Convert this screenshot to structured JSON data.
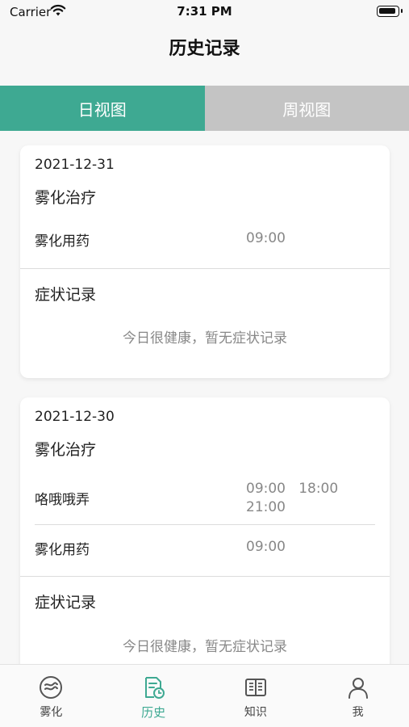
{
  "status_bar": {
    "carrier": "Carrier",
    "time": "7:31 PM"
  },
  "nav": {
    "title": "历史记录"
  },
  "tabs": [
    {
      "label": "日视图",
      "active": true
    },
    {
      "label": "周视图",
      "active": false
    }
  ],
  "records": [
    {
      "date": "2021-12-31",
      "treatment_title": "雾化治疗",
      "treatments": [
        {
          "name": "雾化用药",
          "times": "09:00"
        }
      ],
      "symptom_title": "症状记录",
      "symptom_note": "今日很健康，暂无症状记录"
    },
    {
      "date": "2021-12-30",
      "treatment_title": "雾化治疗",
      "treatments": [
        {
          "name": "咯哦哦弄",
          "times_line1": "09:00   18:00",
          "times_line2": "21:00"
        },
        {
          "name": "雾化用药",
          "times": "09:00"
        }
      ],
      "symptom_title": "症状记录",
      "symptom_note": "今日很健康，暂无症状记录"
    }
  ],
  "bottom_nav": [
    {
      "label": "雾化",
      "icon": "nebulizer-icon",
      "active": false
    },
    {
      "label": "历史",
      "icon": "history-icon",
      "active": true
    },
    {
      "label": "知识",
      "icon": "book-icon",
      "active": false
    },
    {
      "label": "我",
      "icon": "profile-icon",
      "active": false
    }
  ],
  "colors": {
    "accent": "#3ea992",
    "tab_inactive": "#c4c4c4"
  }
}
